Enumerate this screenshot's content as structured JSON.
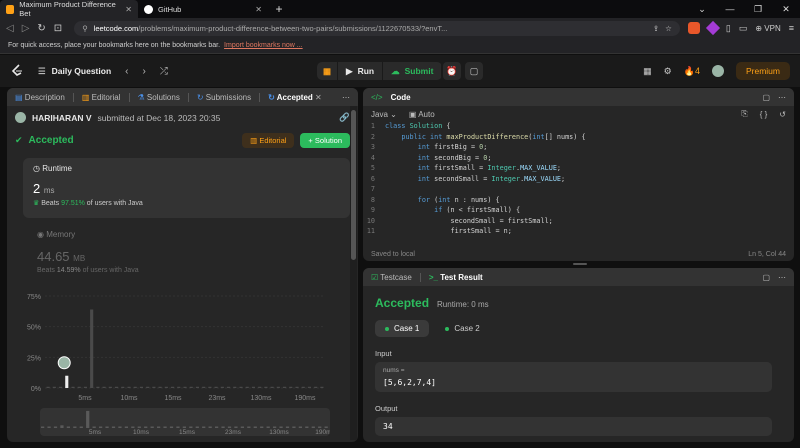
{
  "browser": {
    "tabs": [
      {
        "title": "Maximum Product Difference Bet",
        "active": true
      },
      {
        "title": "GitHub",
        "active": false
      }
    ],
    "url_domain": "leetcode.com",
    "url_path": "/problems/maximum-product-difference-between-two-pairs/submissions/1122670533/?envT...",
    "vpn": "VPN",
    "bookmarks_text": "For quick access, place your bookmarks here on the bookmarks bar.",
    "bookmarks_link": "Import bookmarks now ..."
  },
  "topbar": {
    "title": "Daily Question",
    "run": "Run",
    "submit": "Submit",
    "streak": "4",
    "premium": "Premium"
  },
  "left_tabs": {
    "description": "Description",
    "editorial": "Editorial",
    "solutions": "Solutions",
    "submissions": "Submissions",
    "accepted": "Accepted"
  },
  "submission": {
    "user": "HARIHARAN V",
    "submitted": "submitted at Dec 18, 2023 20:35",
    "status": "Accepted",
    "editorial_btn": "Editorial",
    "solution_btn": "Solution",
    "runtime_label": "Runtime",
    "runtime_value": "2",
    "runtime_unit": "ms",
    "runtime_beats_prefix": "Beats",
    "runtime_beats": "97.51%",
    "runtime_beats_suffix": "of users with Java",
    "memory_label": "Memory",
    "memory_value": "44.65",
    "memory_unit": "MB",
    "memory_beats_prefix": "Beats",
    "memory_beats": "14.59%",
    "memory_beats_suffix": "of users with Java"
  },
  "chart_data": {
    "type": "bar",
    "y_ticks": [
      "75%",
      "50%",
      "25%",
      "0%"
    ],
    "x_ticks": [
      "5ms",
      "10ms",
      "15ms",
      "23ms",
      "130ms",
      "190ms"
    ],
    "ylim": [
      0,
      100
    ],
    "series": [
      {
        "values": [
          1,
          1,
          1,
          10,
          1,
          1,
          1,
          64,
          1,
          1,
          1,
          1,
          1,
          1,
          1,
          1,
          1,
          1,
          1,
          1,
          1,
          1,
          1,
          1,
          1,
          1,
          1,
          1,
          1,
          1,
          1,
          1,
          1,
          1,
          1,
          1,
          1,
          1,
          1,
          1,
          1,
          1,
          1,
          1,
          1
        ]
      }
    ],
    "highlight_index": 3
  },
  "code": {
    "title": "Code",
    "lang": "Java",
    "auto": "Auto",
    "saved": "Saved to local",
    "position": "Ln 5, Col 44",
    "lines": [
      "class Solution {",
      "    public int maxProductDifference(int[] nums) {",
      "        int firstBig = 0;",
      "        int secondBig = 0;",
      "        int firstSmall = Integer.MAX_VALUE;",
      "        int secondSmall = Integer.MAX_VALUE;",
      "",
      "        for (int n : nums) {",
      "            if (n < firstSmall) {",
      "                secondSmall = firstSmall;",
      "                firstSmall = n;"
    ]
  },
  "result": {
    "testcase_tab": "Testcase",
    "result_tab": "Test Result",
    "status": "Accepted",
    "runtime": "Runtime: 0 ms",
    "case1": "Case 1",
    "case2": "Case 2",
    "input_label": "Input",
    "input_name": "nums =",
    "input_value": "[5,6,2,7,4]",
    "output_label": "Output",
    "output_value": "34"
  }
}
